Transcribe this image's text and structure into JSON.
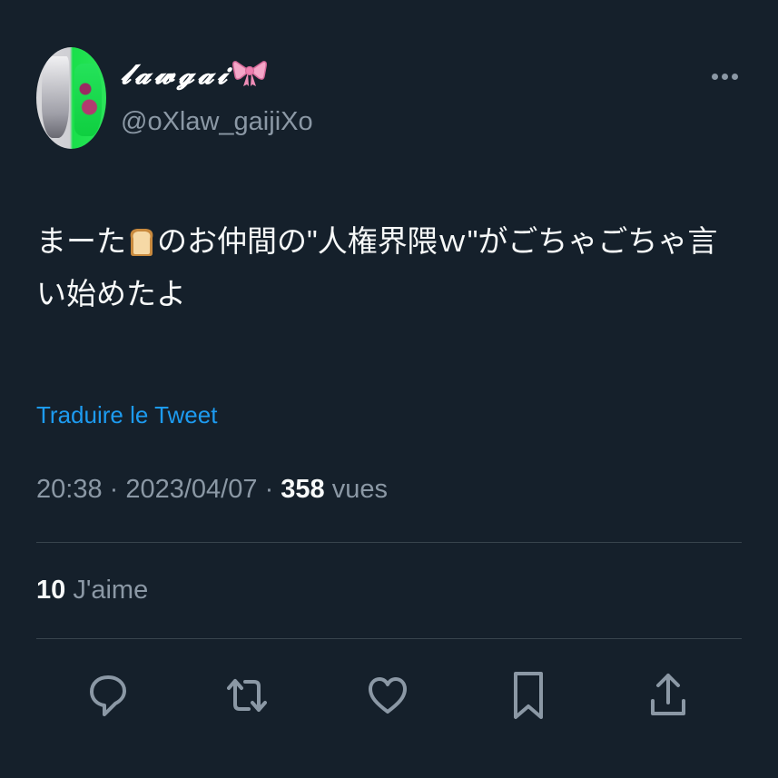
{
  "user": {
    "display_name": "𝓵𝓪𝔀𝓰𝓪𝓲",
    "handle": "@oXlaw_gaijiXo"
  },
  "tweet": {
    "text_before_emoji": "まーた",
    "text_after_emoji": "のお仲間の\"人権界隈ｗ\"がごちゃごちゃ言い始めたよ",
    "translate_label": "Traduire le Tweet"
  },
  "meta": {
    "time": "20:38",
    "separator": " · ",
    "date": "2023/04/07",
    "views_count": "358",
    "views_label": "vues"
  },
  "stats": {
    "likes_count": "10",
    "likes_label": "J'aime"
  },
  "icons": {
    "avatar": "avatar",
    "bow": "ribbon-bow-icon",
    "bread": "bread-emoji-icon",
    "more": "more-dots-icon",
    "reply": "reply-icon",
    "retweet": "retweet-icon",
    "like": "heart-icon",
    "bookmark": "bookmark-icon",
    "share": "share-icon"
  },
  "colors": {
    "background": "#15202b",
    "text": "#f7f9f9",
    "secondary": "#8b98a5",
    "link": "#1d9bf0",
    "divider": "#38444d"
  }
}
